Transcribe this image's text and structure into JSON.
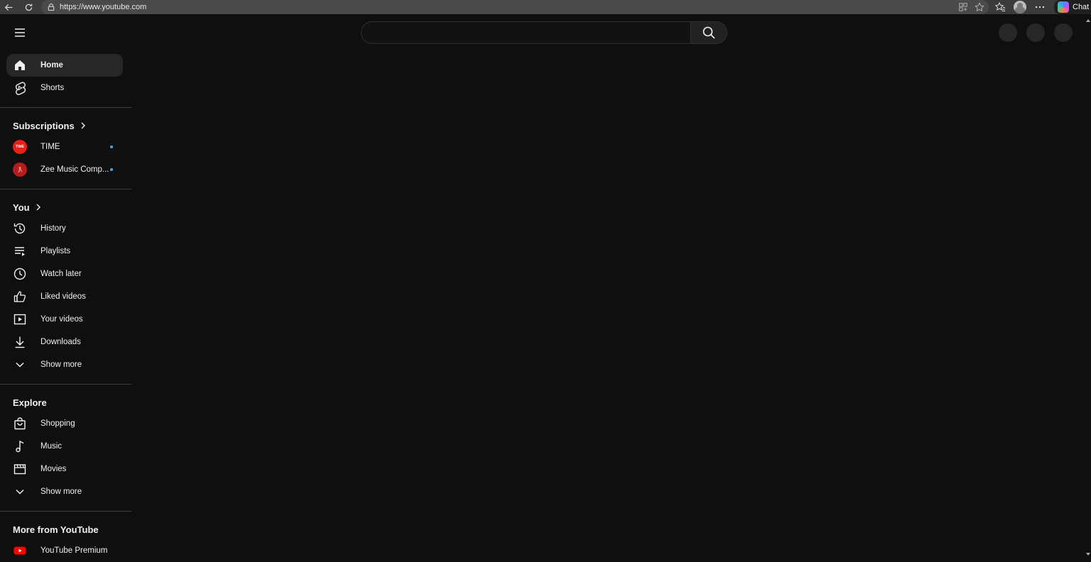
{
  "browser": {
    "url": "https://www.youtube.com",
    "chat_label": "Chat"
  },
  "masthead": {
    "search_placeholder": ""
  },
  "sidebar": {
    "top": [
      {
        "label": "Home",
        "icon": "home-icon"
      },
      {
        "label": "Shorts",
        "icon": "shorts-icon"
      }
    ],
    "subscriptions": {
      "title": "Subscriptions",
      "channels": [
        {
          "label": "TIME",
          "avatar_text": "TIME",
          "color": "#e62117"
        },
        {
          "label": "Zee Music Comp...",
          "avatar_text": "",
          "color": "#b71c1c"
        }
      ]
    },
    "you": {
      "title": "You",
      "items": [
        {
          "label": "History",
          "icon": "history-icon"
        },
        {
          "label": "Playlists",
          "icon": "playlists-icon"
        },
        {
          "label": "Watch later",
          "icon": "watch-later-icon"
        },
        {
          "label": "Liked videos",
          "icon": "thumbs-up-icon"
        },
        {
          "label": "Your videos",
          "icon": "your-videos-icon"
        },
        {
          "label": "Downloads",
          "icon": "download-icon"
        },
        {
          "label": "Show more",
          "icon": "chevron-down-icon"
        }
      ]
    },
    "explore": {
      "title": "Explore",
      "items": [
        {
          "label": "Shopping",
          "icon": "shopping-bag-icon"
        },
        {
          "label": "Music",
          "icon": "music-note-icon"
        },
        {
          "label": "Movies",
          "icon": "clapperboard-icon"
        },
        {
          "label": "Show more",
          "icon": "chevron-down-icon"
        }
      ]
    },
    "more": {
      "title": "More from YouTube",
      "items": [
        {
          "label": "YouTube Premium",
          "icon": "youtube-premium-icon"
        }
      ]
    }
  },
  "colors": {
    "background": "#0f0f0f",
    "active_item": "#272727",
    "new_dot": "#3ea6ff",
    "youtube_red": "#ff0000"
  }
}
